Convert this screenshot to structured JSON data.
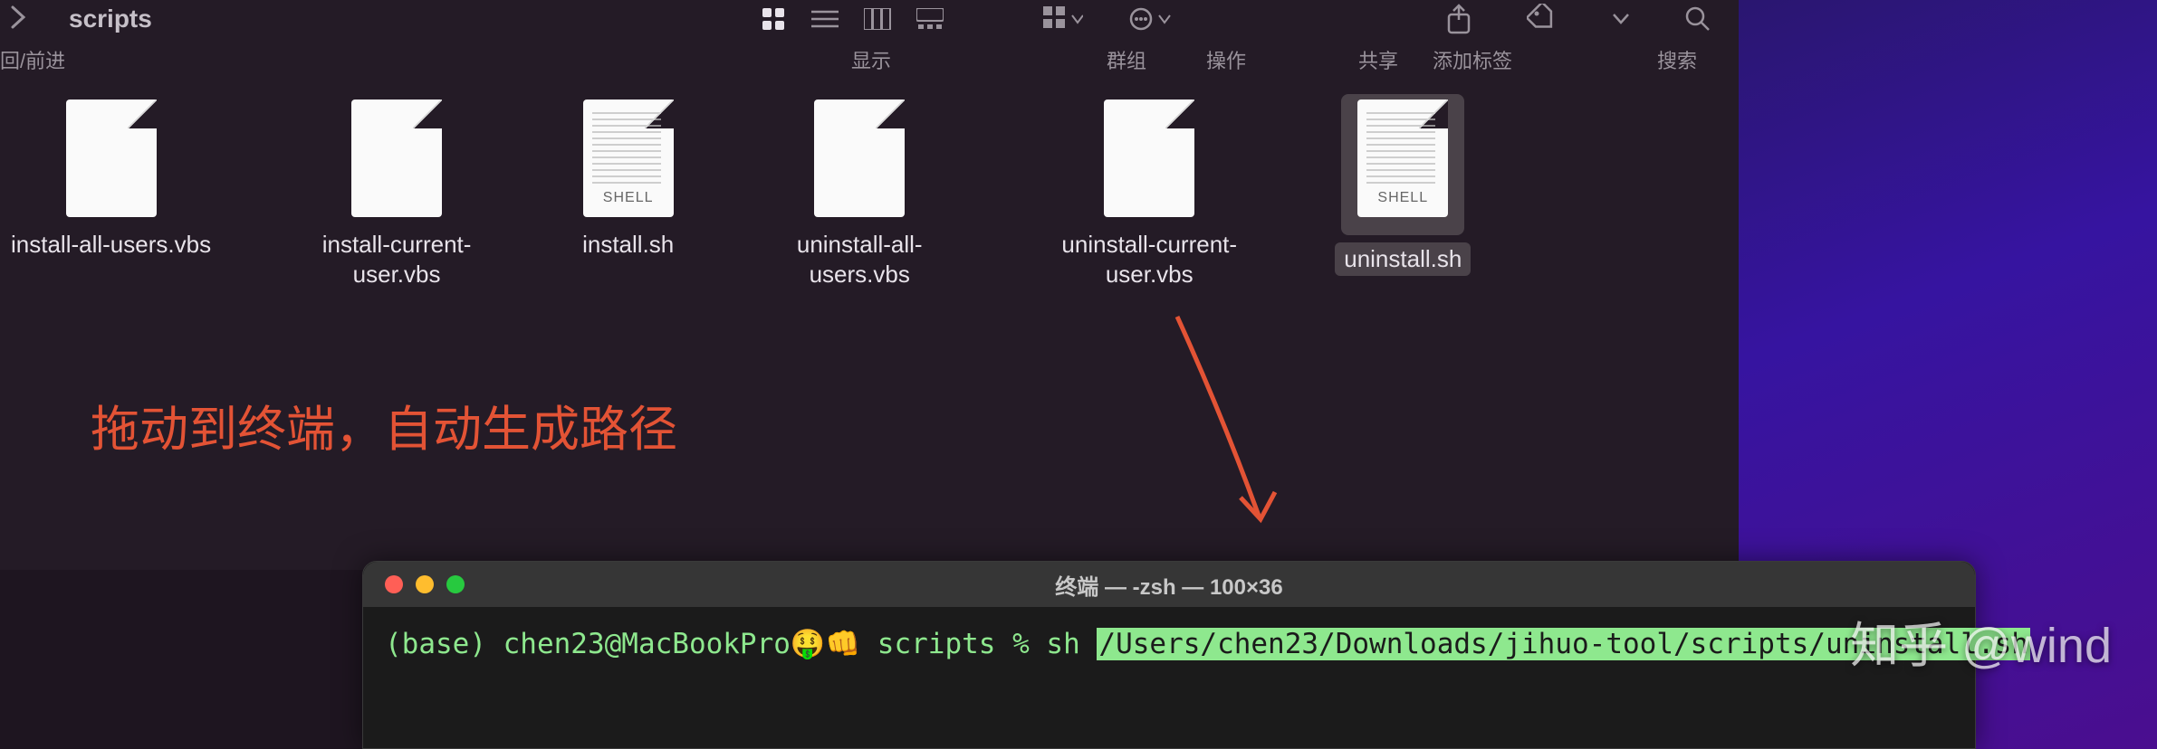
{
  "finder": {
    "title": "scripts",
    "nav_label": "回/前进",
    "toolbar_labels": {
      "view": "显示",
      "group": "群组",
      "action": "操作",
      "share": "共享",
      "tag": "添加标签",
      "search": "搜索"
    },
    "files": [
      {
        "name": "install-all-users.vbs",
        "type": "plain"
      },
      {
        "name": "install-current-user.vbs",
        "type": "plain"
      },
      {
        "name": "install.sh",
        "type": "shell",
        "shell_label": "SHELL"
      },
      {
        "name": "uninstall-all-users.vbs",
        "type": "plain"
      },
      {
        "name": "uninstall-current-user.vbs",
        "type": "plain"
      },
      {
        "name": "uninstall.sh",
        "type": "shell",
        "shell_label": "SHELL",
        "selected": true
      }
    ]
  },
  "annotation": {
    "text": "拖动到终端，自动生成路径",
    "color": "#e35335"
  },
  "terminal": {
    "title": "终端 — -zsh — 100×36",
    "prompt": "(base) chen23@MacBookPro🤑👊 scripts % sh ",
    "path": "/Users/chen23/Downloads/jihuo-tool/scripts/uninstall.sh"
  },
  "watermark": "知乎 @wind"
}
